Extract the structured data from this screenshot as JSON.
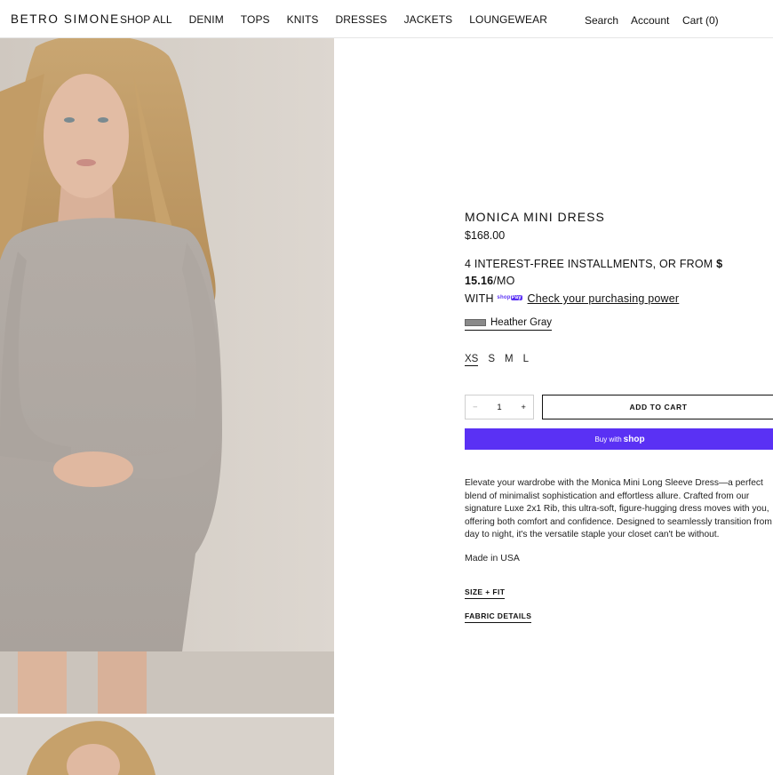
{
  "brand": {
    "name": "BETRO SIMONE"
  },
  "nav": {
    "items": [
      "SHOP ALL",
      "DENIM",
      "TOPS",
      "KNITS",
      "DRESSES",
      "JACKETS",
      "LOUNGEWEAR"
    ]
  },
  "utility": {
    "search": "Search",
    "account": "Account",
    "cart": "Cart (0)"
  },
  "product": {
    "title": "MONICA MINI DRESS",
    "price": "$168.00",
    "installments": {
      "prefix": "4 INTEREST-FREE INSTALLMENTS, OR FROM ",
      "amount": "$ 15.16",
      "suffix": "/MO",
      "with": "WITH",
      "shoppay_text": "shop",
      "shoppay_pay": "Pay",
      "link": "Check your purchasing power"
    },
    "color": {
      "label": "Heather Gray",
      "swatch_color": "#8a8a8a"
    },
    "sizes": [
      "XS",
      "S",
      "M",
      "L"
    ],
    "selected_size": "XS",
    "quantity": {
      "minus": "−",
      "value": "1",
      "plus": "+"
    },
    "add_to_cart": "ADD TO CART",
    "buy_with": {
      "prefix": "Buy with",
      "brand": "shop"
    },
    "description": "Elevate your wardrobe with the Monica Mini Long Sleeve Dress—a perfect blend of minimalist sophistication and effortless allure. Crafted from our signature Luxe 2x1 Rib, this ultra-soft, figure-hugging dress moves with you, offering both comfort and confidence. Designed to seamlessly transition from day to night, it's the versatile staple your closet can't be without.",
    "made_in": "Made in USA",
    "accordions": [
      "SIZE + FIT",
      "FABRIC DETAILS"
    ]
  },
  "colors": {
    "accent": "#5a31f4",
    "photo_bg": "#d5cfc8"
  }
}
